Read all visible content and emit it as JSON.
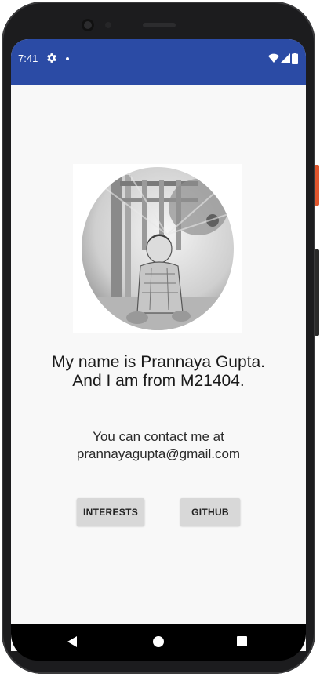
{
  "status_bar": {
    "time": "7:41",
    "icons": [
      "gear-icon",
      "notification-dot",
      "wifi-icon",
      "signal-icon",
      "battery-icon"
    ],
    "color": "#2b4ba5"
  },
  "profile": {
    "photo_alt": "profile-photo",
    "headline_line1": "My name is Prannaya Gupta.",
    "headline_line2": "And I am from M21404.",
    "contact_line1": "You can contact me at",
    "contact_line2": "prannayagupta@gmail.com"
  },
  "buttons": {
    "interests": "INTERESTS",
    "github": "GITHUB"
  },
  "nav_bar": {
    "icons": [
      "back-icon",
      "home-icon",
      "recents-icon"
    ]
  }
}
